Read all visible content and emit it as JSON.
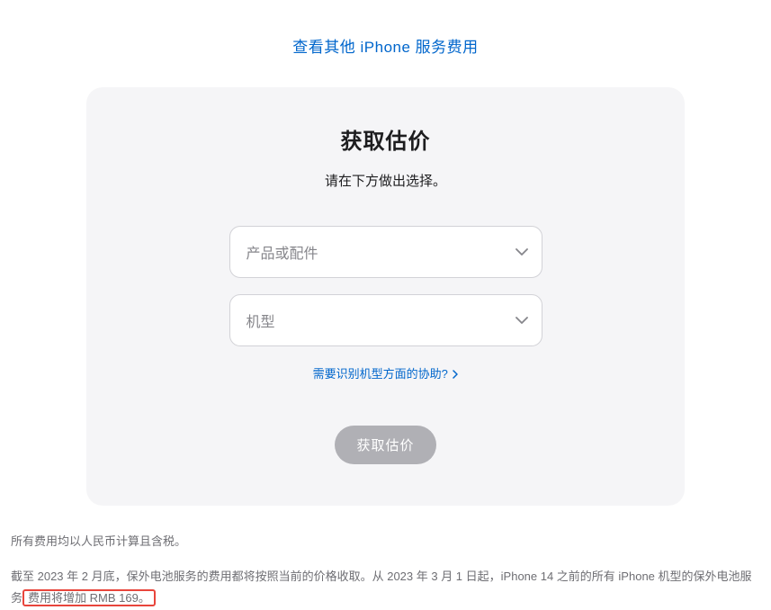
{
  "topLink": {
    "label": "查看其他 iPhone 服务费用"
  },
  "card": {
    "title": "获取估价",
    "subtitle": "请在下方做出选择。",
    "select1": {
      "placeholder": "产品或配件"
    },
    "select2": {
      "placeholder": "机型"
    },
    "helpLink": {
      "label": "需要识别机型方面的协助?"
    },
    "submit": {
      "label": "获取估价"
    }
  },
  "footnotes": {
    "line1": "所有费用均以人民币计算且含税。",
    "line2_part1": "截至 2023 年 2 月底，保外电池服务的费用都将按照当前的价格收取。从 2023 年 3 月 1 日起，iPhone 14 之前的所有 iPhone 机型的保外电池服务",
    "line2_highlight": "费用将增加 RMB 169。"
  }
}
